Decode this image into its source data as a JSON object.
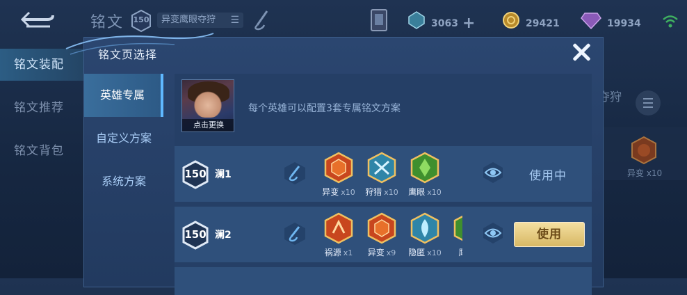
{
  "background": {
    "title": "铭文",
    "level": "150",
    "page_name": "异变鹰眼夺狩",
    "resources": [
      {
        "icon": "crystal-icon",
        "value": "3063"
      },
      {
        "icon": "gold-coin-icon",
        "value": "29421"
      },
      {
        "icon": "diamond-icon",
        "value": "19934"
      }
    ],
    "side_nav": [
      "铭文装配",
      "铭文推荐",
      "铭文背包"
    ],
    "right_ghost_text": "夺狩",
    "right_ghost_rune_label": "异变 x10"
  },
  "modal": {
    "title": "铭文页选择",
    "tabs": [
      "英雄专属",
      "自定义方案",
      "系统方案"
    ],
    "hero_caption": "点击更换",
    "hint": "每个英雄可以配置3套专属铭文方案",
    "pages": [
      {
        "level": "150",
        "name": "澜1",
        "runes": [
          {
            "name": "异变",
            "count": "x10",
            "color": "#d84a1f"
          },
          {
            "name": "狩猎",
            "count": "x10",
            "color": "#3fa0c8"
          },
          {
            "name": "鹰眼",
            "count": "x10",
            "color": "#4aa53a"
          }
        ],
        "status": "使用中"
      },
      {
        "level": "150",
        "name": "澜2",
        "runes": [
          {
            "name": "祸源",
            "count": "x1",
            "color": "#d84a1f"
          },
          {
            "name": "异变",
            "count": "x9",
            "color": "#d84a1f"
          },
          {
            "name": "隐匿",
            "count": "x10",
            "color": "#3fa0c8"
          },
          {
            "name": "鹰眼",
            "count": "",
            "color": "#4aa53a"
          }
        ],
        "action": "使用"
      }
    ]
  },
  "colors": {
    "accent": "#5fb8ff",
    "use_button": "#e6cc82"
  }
}
